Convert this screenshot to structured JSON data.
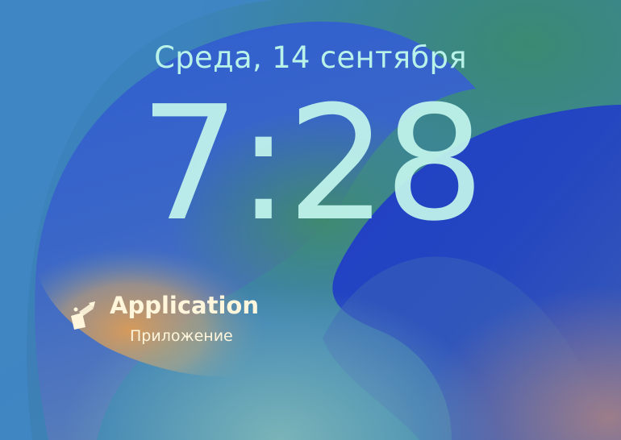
{
  "lock_screen": {
    "date": "Среда, 14 сентября",
    "time": "7:28"
  },
  "widget": {
    "icon": "app-install-icon",
    "title": "Application",
    "subtitle": "Приложение"
  },
  "colors": {
    "clock_text": "#c2f5ed",
    "widget_text": "#fff6dc",
    "wallpaper_blue": "#1d3fc2",
    "wallpaper_green": "#3f8a80",
    "wallpaper_orange": "#c89a5c"
  }
}
